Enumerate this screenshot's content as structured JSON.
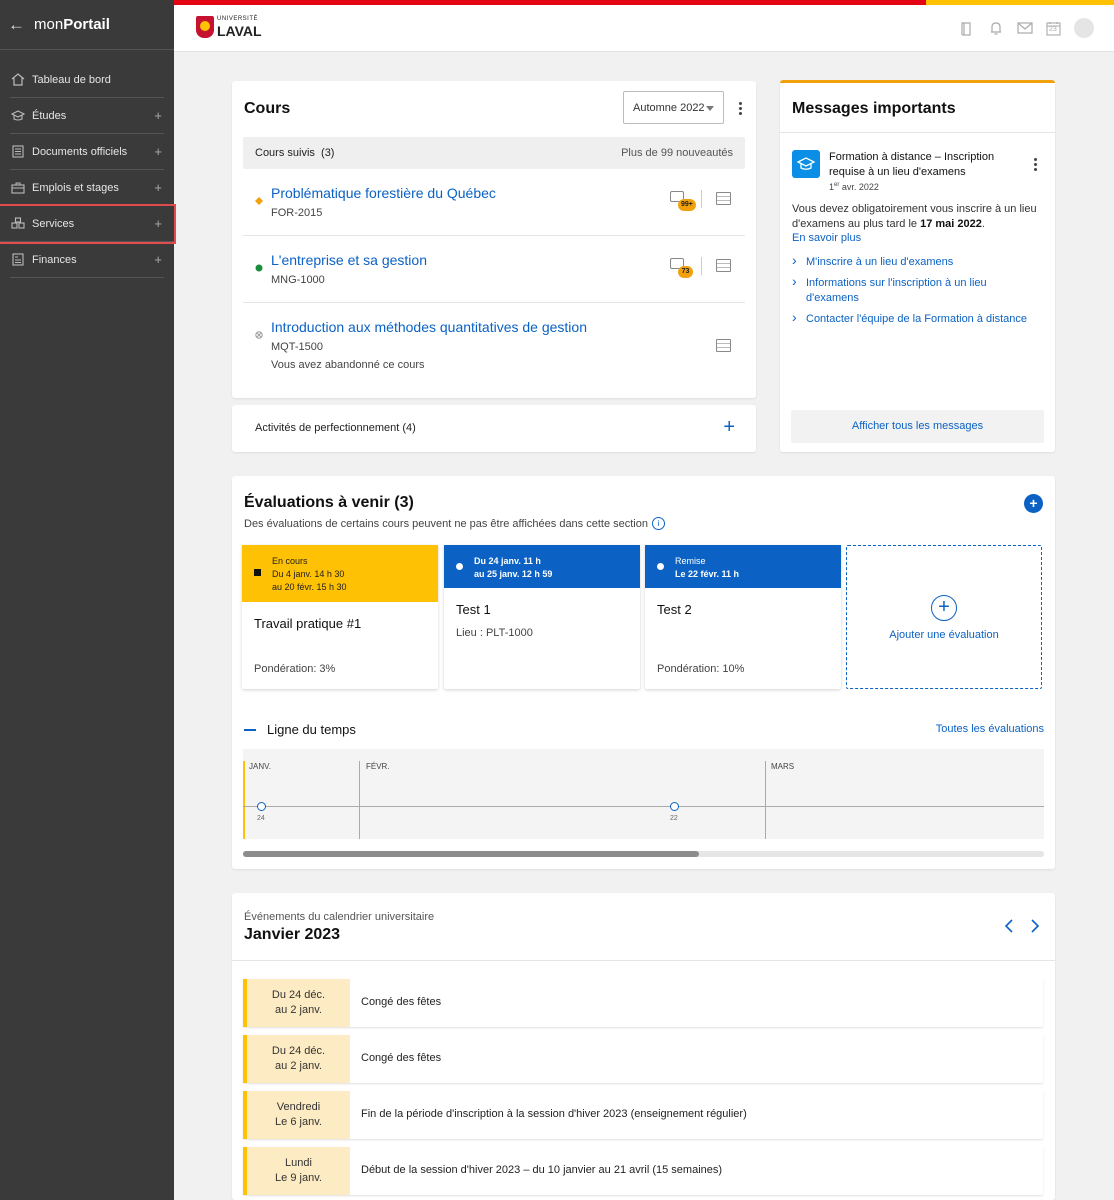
{
  "sidebar": {
    "back_icon": "arrow-left-icon",
    "brand_light": "mon",
    "brand_bold": "Portail",
    "items": [
      {
        "label": "Tableau de bord",
        "icon": "home-icon",
        "expandable": false
      },
      {
        "label": "Études",
        "icon": "graduation-cap-icon",
        "expandable": true
      },
      {
        "label": "Documents officiels",
        "icon": "document-icon",
        "expandable": true
      },
      {
        "label": "Emplois et stages",
        "icon": "briefcase-icon",
        "expandable": true
      },
      {
        "label": "Services",
        "icon": "services-icon",
        "expandable": true,
        "highlighted": true
      },
      {
        "label": "Finances",
        "icon": "finance-icon",
        "expandable": true
      }
    ]
  },
  "topbar": {
    "logo_small": "UNIVERSITÉ",
    "logo_big": "LAVAL",
    "calendar_day": "23",
    "colors": {
      "red": "#e30513",
      "yellow": "#ffc103"
    }
  },
  "cours": {
    "title": "Cours",
    "session": "Automne 2022",
    "followed_label": "Cours suivis",
    "followed_count": "(3)",
    "news": "Plus de 99 nouveautés",
    "courses": [
      {
        "name": "Problématique forestière du Québec",
        "code": "FOR-2015",
        "badge": "99+",
        "status": "diamond-yellow"
      },
      {
        "name": "L'entreprise et sa gestion",
        "code": "MNG-1000",
        "badge": "73",
        "status": "dot-green"
      },
      {
        "name": "Introduction aux méthodes quantitatives de gestion",
        "code": "MQT-1500",
        "note": "Vous avez abandonné ce cours",
        "status": "abandoned"
      }
    ],
    "activities": "Activités de perfectionnement (4)"
  },
  "messages": {
    "title": "Messages importants",
    "item_title": "Formation à distance – Inscription requise à un lieu d'examens",
    "date_day": "1",
    "date_sup": "er",
    "date_rest": " avr. 2022",
    "body_pre": "Vous devez obligatoirement vous inscrire à un lieu d'examens au plus tard le ",
    "body_bold": "17 mai 2022",
    "body_post": ".",
    "more": "En savoir plus",
    "links": [
      "M'inscrire à un lieu d'examens",
      "Informations sur l'inscription à un lieu d'examens",
      "Contacter l'équipe de la Formation à distance"
    ],
    "all": "Afficher tous les messages"
  },
  "evaluations": {
    "title": "Évaluations à venir (3)",
    "subtitle": "Des évaluations de certains cours peuvent ne pas être affichées dans cette section",
    "cards": [
      {
        "state": "En cours",
        "line1": "Du 4 janv. 14 h 30",
        "line2": "au 20 févr. 15 h 30",
        "title": "Travail pratique #1",
        "meta": "Pondération: 3%"
      },
      {
        "state": "",
        "line1": "Du 24 janv. 11 h",
        "line2": "au 25 janv. 12 h 59",
        "title": "Test 1",
        "meta": "Lieu : PLT-1000"
      },
      {
        "state": "Remise",
        "line1": "Le 22 févr. 11 h",
        "line2": "",
        "title": "Test 2",
        "meta": "Pondération: 10%"
      }
    ],
    "add_label": "Ajouter une évaluation",
    "timeline_title": "Ligne du temps",
    "timeline_all": "Toutes les évaluations",
    "months": [
      "JANV.",
      "FÉVR.",
      "MARS"
    ],
    "points": [
      "24",
      "22"
    ]
  },
  "calendar": {
    "caption": "Événements du calendrier universitaire",
    "month": "Janvier 2023",
    "events": [
      {
        "d1": "Du 24 déc.",
        "d2": "au 2 janv.",
        "text": "Congé des fêtes"
      },
      {
        "d1": "Du 24 déc.",
        "d2": "au 2 janv.",
        "text": "Congé des fêtes"
      },
      {
        "d1": "Vendredi",
        "d2": "Le 6 janv.",
        "text": "Fin de la période d'inscription à la session d'hiver 2023 (enseignement régulier)"
      },
      {
        "d1": "Lundi",
        "d2": "Le 9 janv.",
        "text": "Début de la session d'hiver 2023 – du 10 janvier au 21 avril (15 semaines)"
      }
    ]
  }
}
